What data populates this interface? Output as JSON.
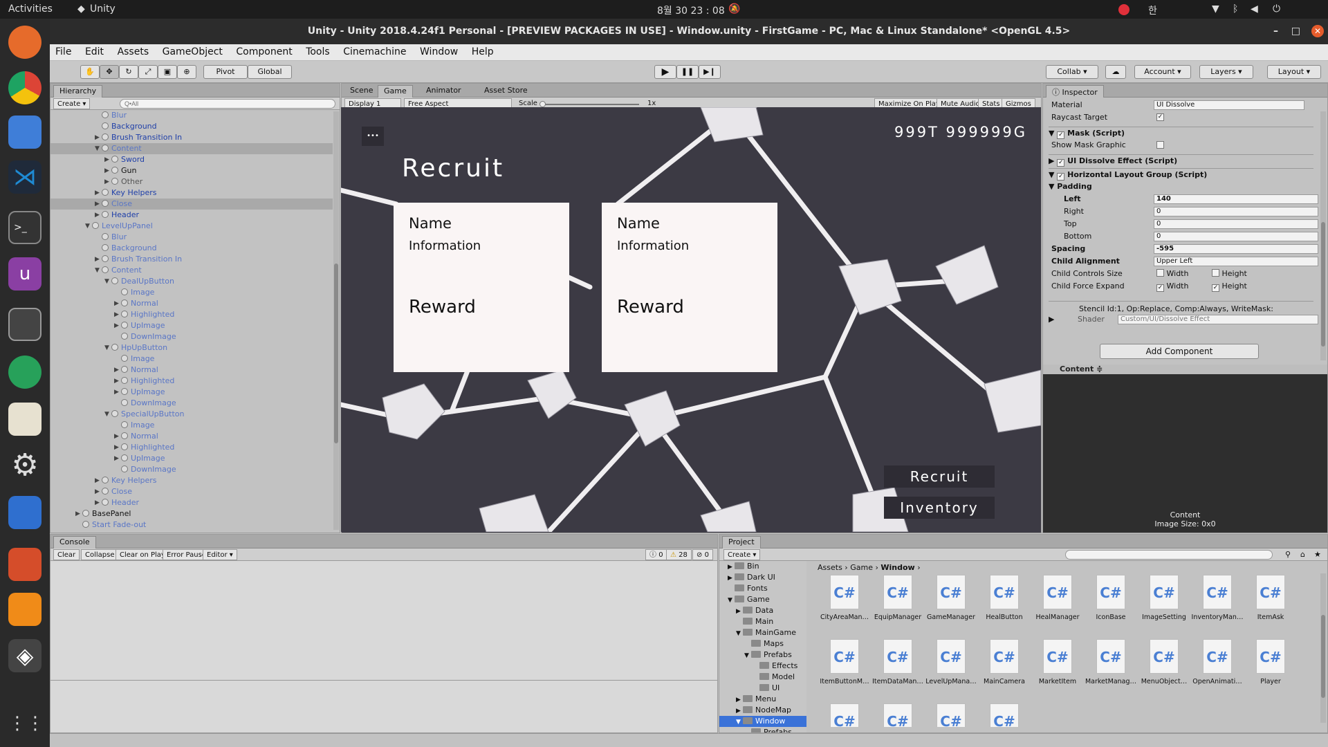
{
  "topbar": {
    "activities": "Activities",
    "app": "Unity",
    "clock": "8월 30 23 : 08",
    "lang": "한"
  },
  "titlebar": {
    "title": "Unity - Unity 2018.4.24f1 Personal - [PREVIEW PACKAGES IN USE] - Window.unity - FirstGame - PC, Mac & Linux Standalone* <OpenGL 4.5>"
  },
  "menus": [
    "File",
    "Edit",
    "Assets",
    "GameObject",
    "Component",
    "Tools",
    "Cinemachine",
    "Window",
    "Help"
  ],
  "toolbar": {
    "pivot": "Pivot",
    "global": "Global",
    "collab": "Collab",
    "account": "Account",
    "layers": "Layers",
    "layout": "Layout"
  },
  "hierarchy": {
    "tab": "Hierarchy",
    "create": "Create",
    "search_placeholder": "Q•All",
    "rows": [
      {
        "label": "Blur",
        "style": "prefabdim",
        "depth": 6,
        "tri": ""
      },
      {
        "label": "Background",
        "style": "prefab",
        "depth": 6,
        "tri": ""
      },
      {
        "label": "Brush Transition In",
        "style": "prefab",
        "depth": 6,
        "tri": "▶"
      },
      {
        "label": "Content",
        "style": "prefabdim",
        "depth": 6,
        "tri": "▼",
        "sel": true
      },
      {
        "label": "Sword",
        "style": "prefab",
        "depth": 7,
        "tri": "▶"
      },
      {
        "label": "Gun",
        "style": "",
        "depth": 7,
        "tri": "▶"
      },
      {
        "label": "Other",
        "style": "dim",
        "depth": 7,
        "tri": "▶"
      },
      {
        "label": "Key Helpers",
        "style": "prefab",
        "depth": 6,
        "tri": "▶"
      },
      {
        "label": "Close",
        "style": "prefabdim",
        "depth": 6,
        "tri": "▶",
        "sel": true
      },
      {
        "label": "Header",
        "style": "prefab",
        "depth": 6,
        "tri": "▶"
      },
      {
        "label": "LevelUpPanel",
        "style": "prefabdim",
        "depth": 5,
        "tri": "▼"
      },
      {
        "label": "Blur",
        "style": "prefabdim",
        "depth": 6,
        "tri": ""
      },
      {
        "label": "Background",
        "style": "prefabdim",
        "depth": 6,
        "tri": ""
      },
      {
        "label": "Brush Transition In",
        "style": "prefabdim",
        "depth": 6,
        "tri": "▶"
      },
      {
        "label": "Content",
        "style": "prefabdim",
        "depth": 6,
        "tri": "▼"
      },
      {
        "label": "DealUpButton",
        "style": "prefabdim",
        "depth": 7,
        "tri": "▼"
      },
      {
        "label": "Image",
        "style": "prefabdim",
        "depth": 8,
        "tri": ""
      },
      {
        "label": "Normal",
        "style": "prefabdim",
        "depth": 8,
        "tri": "▶"
      },
      {
        "label": "Highlighted",
        "style": "prefabdim",
        "depth": 8,
        "tri": "▶"
      },
      {
        "label": "UpImage",
        "style": "prefabdim",
        "depth": 8,
        "tri": "▶"
      },
      {
        "label": "DownImage",
        "style": "prefabdim",
        "depth": 8,
        "tri": ""
      },
      {
        "label": "HpUpButton",
        "style": "prefabdim",
        "depth": 7,
        "tri": "▼"
      },
      {
        "label": "Image",
        "style": "prefabdim",
        "depth": 8,
        "tri": ""
      },
      {
        "label": "Normal",
        "style": "prefabdim",
        "depth": 8,
        "tri": "▶"
      },
      {
        "label": "Highlighted",
        "style": "prefabdim",
        "depth": 8,
        "tri": "▶"
      },
      {
        "label": "UpImage",
        "style": "prefabdim",
        "depth": 8,
        "tri": "▶"
      },
      {
        "label": "DownImage",
        "style": "prefabdim",
        "depth": 8,
        "tri": ""
      },
      {
        "label": "SpecialUpButton",
        "style": "prefabdim",
        "depth": 7,
        "tri": "▼"
      },
      {
        "label": "Image",
        "style": "prefabdim",
        "depth": 8,
        "tri": ""
      },
      {
        "label": "Normal",
        "style": "prefabdim",
        "depth": 8,
        "tri": "▶"
      },
      {
        "label": "Highlighted",
        "style": "prefabdim",
        "depth": 8,
        "tri": "▶"
      },
      {
        "label": "UpImage",
        "style": "prefabdim",
        "depth": 8,
        "tri": "▶"
      },
      {
        "label": "DownImage",
        "style": "prefabdim",
        "depth": 8,
        "tri": ""
      },
      {
        "label": "Key Helpers",
        "style": "prefabdim",
        "depth": 6,
        "tri": "▶"
      },
      {
        "label": "Close",
        "style": "prefabdim",
        "depth": 6,
        "tri": "▶"
      },
      {
        "label": "Header",
        "style": "prefabdim",
        "depth": 6,
        "tri": "▶"
      },
      {
        "label": "BasePanel",
        "style": "",
        "depth": 4,
        "tri": "▶"
      },
      {
        "label": "Start Fade-out",
        "style": "prefabdim",
        "depth": 4,
        "tri": ""
      }
    ]
  },
  "scene_tabs": {
    "scene": "Scene",
    "game": "Game",
    "animator": "Animator",
    "asset_store": "Asset Store"
  },
  "game_bar": {
    "display": "Display 1",
    "aspect": "Free Aspect",
    "scale_label": "Scale",
    "scale_value": "1x",
    "maximize": "Maximize On Play",
    "mute": "Mute Audio",
    "stats": "Stats",
    "gizmos": "Gizmos"
  },
  "game": {
    "currency": "999T  999999G",
    "menu_dots": "•••",
    "heading": "Recruit",
    "cards": [
      {
        "name": "Name",
        "info": "Information",
        "reward": "Reward"
      },
      {
        "name": "Name",
        "info": "Information",
        "reward": "Reward"
      }
    ],
    "buttons": {
      "recruit": "Recruit",
      "inventory": "Inventory"
    }
  },
  "inspector": {
    "tab": "Inspector",
    "material_label": "Material",
    "material_value": "UI Dissolve",
    "raycast_label": "Raycast Target",
    "mask": "Mask (Script)",
    "show_mask": "Show Mask Graphic",
    "dissolve": "UI Dissolve Effect (Script)",
    "hlg": "Horizontal Layout Group (Script)",
    "padding": "Padding",
    "left_label": "Left",
    "left_value": "140",
    "right_label": "Right",
    "right_value": "0",
    "top_label": "Top",
    "top_value": "0",
    "bottom_label": "Bottom",
    "bottom_value": "0",
    "spacing_label": "Spacing",
    "spacing_value": "-595",
    "align_label": "Child Alignment",
    "align_value": "Upper Left",
    "controls_label": "Child Controls Size",
    "expand_label": "Child Force Expand",
    "width": "Width",
    "height": "Height",
    "stencil": "Stencil Id:1, Op:Replace, Comp:Always, WriteMask:",
    "shader_label": "Shader",
    "shader_value": "Custom/UI/Dissolve Effect",
    "add_component": "Add Component",
    "preview_title": "Content",
    "preview_caption_1": "Content",
    "preview_caption_2": "Image Size: 0x0"
  },
  "console": {
    "tab": "Console",
    "clear": "Clear",
    "collapse": "Collapse",
    "clear_on_play": "Clear on Play",
    "error_pause": "Error Pause",
    "editor": "Editor",
    "count_info": "0",
    "count_warn": "28",
    "count_err": "0"
  },
  "project": {
    "tab": "Project",
    "create": "Create",
    "breadcrumb": [
      "Assets",
      "Game",
      "Window"
    ],
    "tree": [
      {
        "label": "Bin",
        "depth": 1,
        "tri": "▶"
      },
      {
        "label": "Dark UI",
        "depth": 1,
        "tri": "▶"
      },
      {
        "label": "Fonts",
        "depth": 1,
        "tri": ""
      },
      {
        "label": "Game",
        "depth": 1,
        "tri": "▼"
      },
      {
        "label": "Data",
        "depth": 2,
        "tri": "▶"
      },
      {
        "label": "Main",
        "depth": 2,
        "tri": ""
      },
      {
        "label": "MainGame",
        "depth": 2,
        "tri": "▼"
      },
      {
        "label": "Maps",
        "depth": 3,
        "tri": ""
      },
      {
        "label": "Prefabs",
        "depth": 3,
        "tri": "▼"
      },
      {
        "label": "Effects",
        "depth": 4,
        "tri": ""
      },
      {
        "label": "Model",
        "depth": 4,
        "tri": ""
      },
      {
        "label": "UI",
        "depth": 4,
        "tri": ""
      },
      {
        "label": "Menu",
        "depth": 2,
        "tri": "▶"
      },
      {
        "label": "NodeMap",
        "depth": 2,
        "tri": "▶"
      },
      {
        "label": "Window",
        "depth": 2,
        "tri": "▼",
        "sel": true
      },
      {
        "label": "Prefabs",
        "depth": 3,
        "tri": ""
      }
    ],
    "assets": [
      "CityAreaMan…",
      "EquipManager",
      "GameManager",
      "HealButton",
      "HealManager",
      "IconBase",
      "ImageSetting",
      "InventoryMan…",
      "ItemAsk",
      "ItemButtonM…",
      "ItemDataMan…",
      "LevelUpMana…",
      "MainCamera",
      "MarketItem",
      "MarketManag…",
      "MenuObject…",
      "OpenAnimati…",
      "Player",
      "",
      "",
      "",
      ""
    ],
    "cs_label": "C#"
  },
  "colors": {
    "accent": "#3a72d8",
    "game_bg": "#3c3a44",
    "card": "#faf5f5"
  }
}
